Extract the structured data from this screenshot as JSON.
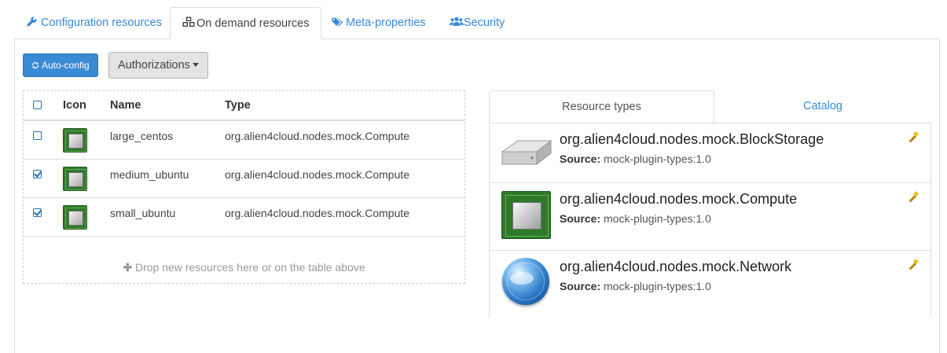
{
  "top_tabs": [
    {
      "label": "Configuration resources",
      "icon": "wrench-icon",
      "active": false
    },
    {
      "label": "On demand resources",
      "icon": "cubes-icon",
      "active": true
    },
    {
      "label": "Meta-properties",
      "icon": "tags-icon",
      "active": false
    },
    {
      "label": "Security",
      "icon": "users-icon",
      "active": false
    }
  ],
  "toolbar": {
    "auto_config_label": "Auto-config",
    "authorizations_label": "Authorizations"
  },
  "resources_table": {
    "headers": {
      "icon": "Icon",
      "name": "Name",
      "type": "Type"
    },
    "rows": [
      {
        "checked": false,
        "name": "large_centos",
        "type": "org.alien4cloud.nodes.mock.Compute"
      },
      {
        "checked": true,
        "name": "medium_ubuntu",
        "type": "org.alien4cloud.nodes.mock.Compute"
      },
      {
        "checked": true,
        "name": "small_ubuntu",
        "type": "org.alien4cloud.nodes.mock.Compute"
      }
    ],
    "drop_hint": "Drop new resources here or on the table above"
  },
  "right_tabs": {
    "resource_types_label": "Resource types",
    "catalog_label": "Catalog"
  },
  "resource_types": [
    {
      "title": "org.alien4cloud.nodes.mock.BlockStorage",
      "source_label": "Source:",
      "source": "mock-plugin-types:1.0",
      "icon": "block-storage-icon"
    },
    {
      "title": "org.alien4cloud.nodes.mock.Compute",
      "source_label": "Source:",
      "source": "mock-plugin-types:1.0",
      "icon": "compute-chip-icon"
    },
    {
      "title": "org.alien4cloud.nodes.mock.Network",
      "source_label": "Source:",
      "source": "mock-plugin-types:1.0",
      "icon": "network-globe-icon"
    }
  ],
  "colors": {
    "link": "#3a8ad6",
    "primary_button": "#3a8ad6",
    "chip_green": "#2f7a2a"
  }
}
